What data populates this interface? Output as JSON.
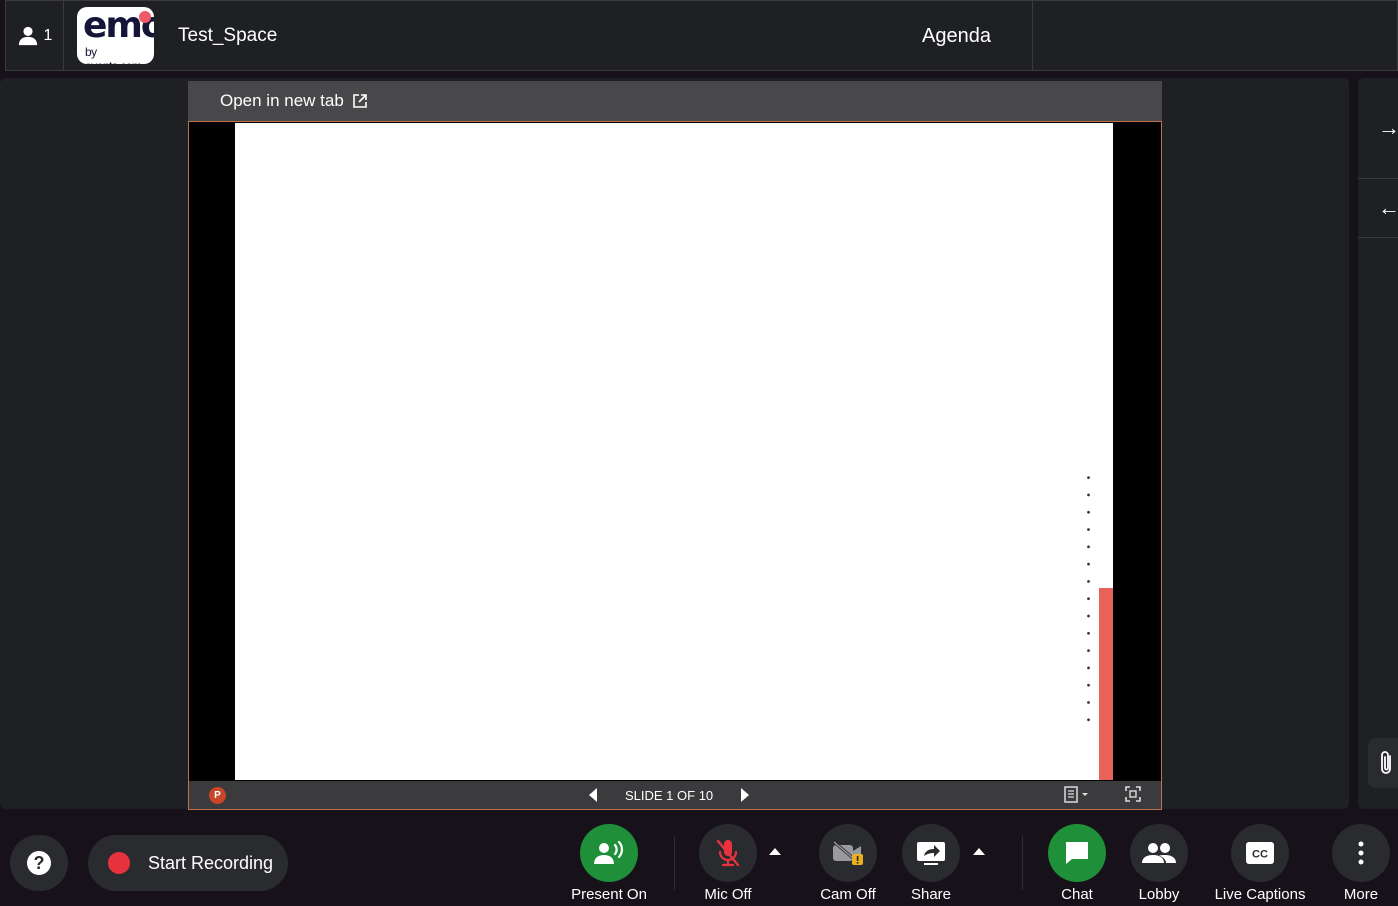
{
  "header": {
    "participant_count": "1",
    "logo_big": "emo",
    "logo_small": "by events.com",
    "space_name": "Test_Space",
    "agenda_label": "Agenda"
  },
  "viewer": {
    "open_new_tab_label": "Open in new tab",
    "ppt_badge": "P",
    "slide_status": "SLIDE 1 OF 10"
  },
  "controls": {
    "start_recording": "Start Recording",
    "present_on": "Present On",
    "mic_off": "Mic Off",
    "cam_off": "Cam Off",
    "share": "Share",
    "chat": "Chat",
    "lobby": "Lobby",
    "live_captions": "Live Captions",
    "more": "More"
  },
  "colors": {
    "present_green": "#1f8f3a",
    "mic_red": "#e8333f",
    "record_red": "#e8333f",
    "slide_accent": "#e8625a"
  }
}
